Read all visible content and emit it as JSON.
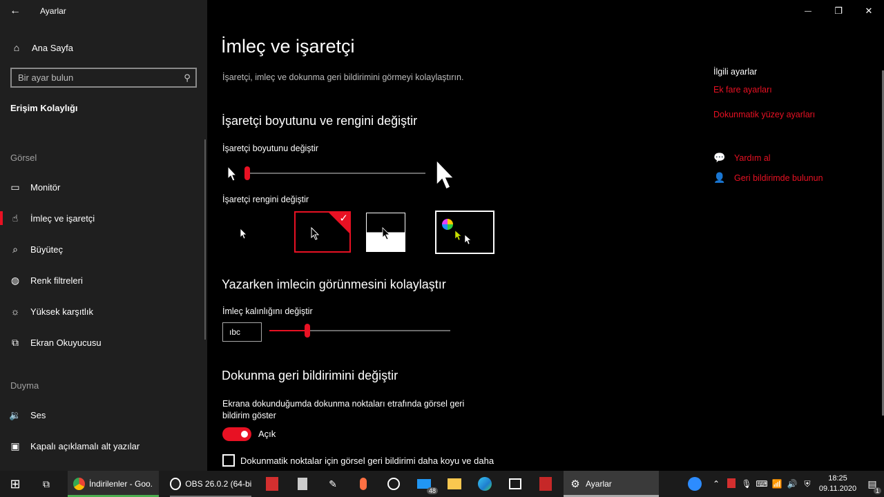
{
  "window": {
    "title": "Ayarlar",
    "back_icon": "←",
    "minimize_icon": "—",
    "maximize_icon": "❐",
    "close_icon": "✕"
  },
  "sidebar": {
    "home_label": "Ana Sayfa",
    "home_icon": "⌂",
    "search_placeholder": "Bir ayar bulun",
    "search_icon": "⚲",
    "category": "Erişim Kolaylığı",
    "groups": [
      {
        "label": "Görsel",
        "items": [
          {
            "label": "Monitör",
            "icon": "▭"
          },
          {
            "label": "İmleç ve işaretçi",
            "icon": "☝",
            "active": true
          },
          {
            "label": "Büyüteç",
            "icon": "⌕"
          },
          {
            "label": "Renk filtreleri",
            "icon": "◍"
          },
          {
            "label": "Yüksek karşıtlık",
            "icon": "☼"
          },
          {
            "label": "Ekran Okuyucusu",
            "icon": "⧉"
          }
        ]
      },
      {
        "label": "Duyma",
        "items": [
          {
            "label": "Ses",
            "icon": "🔉"
          },
          {
            "label": "Kapalı açıklamalı alt yazılar",
            "icon": "▣"
          }
        ]
      }
    ]
  },
  "main": {
    "title": "İmleç ve işaretçi",
    "description": "İşaretçi, imleç ve dokunma geri bildirimini görmeyi kolaylaştırın.",
    "pointer_section": {
      "heading": "İşaretçi boyutunu ve rengini değiştir",
      "size_label": "İşaretçi boyutunu değiştir",
      "size_level": 0,
      "color_label": "İşaretçi rengini değiştir",
      "selected_color_option": "black"
    },
    "cursor_section": {
      "heading": "Yazarken imlecin görünmesini kolaylaştır",
      "thickness_label": "İmleç kalınlığını değiştir",
      "preview_text": "ıbc",
      "thickness_level": 0.21
    },
    "touch_section": {
      "heading": "Dokunma geri bildirimini değiştir",
      "visual_feedback_label": "Ekrana dokunduğumda dokunma noktaları etrafında görsel geri bildirim göster",
      "toggle_state": "Açık",
      "darker_checkbox_label": "Dokunmatik noktalar için görsel geri bildirimi daha koyu ve daha"
    },
    "related": {
      "heading": "İlgili ayarlar",
      "links": [
        "Ek fare ayarları",
        "Dokunmatik yüzey ayarları"
      ],
      "help_label": "Yardım al",
      "help_icon": "💬",
      "feedback_label": "Geri bildirimde bulunun",
      "feedback_icon": "👤"
    }
  },
  "taskbar": {
    "start_icon": "⊞",
    "taskview_icon": "⧉",
    "apps": [
      {
        "label": "İndirilenler - Goo...",
        "color": "#4caf50"
      },
      {
        "label": "OBS 26.0.2 (64-bit...",
        "color": "#ffffff"
      },
      {
        "label": "Ayarlar",
        "color": "#ffffff"
      }
    ],
    "mail_badge": "48",
    "notification_badge": "1",
    "time": "18:25",
    "date": "09.11.2020",
    "accent_color": "#e81123"
  }
}
